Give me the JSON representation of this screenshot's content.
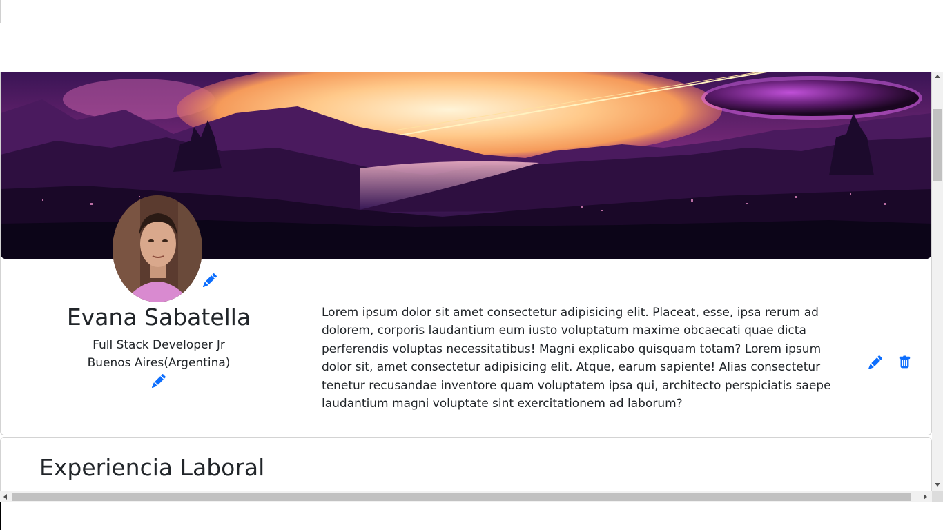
{
  "profile": {
    "name": "Evana Sabatella",
    "job_title": "Full Stack Developer Jr",
    "location": "Buenos Aires(Argentina)",
    "about": "Lorem ipsum dolor sit amet consectetur adipisicing elit. Placeat, esse, ipsa rerum ad dolorem, corporis laudantium eum iusto voluptatum maxime obcaecati quae dicta perferendis voluptas necessitatibus! Magni explicabo quisquam totam? Lorem ipsum dolor sit, amet consectetur adipisicing elit. Atque, earum sapiente! Alias consectetur tenetur recusandae inventore quam voluptatem ipsa qui, architecto perspiciatis saepe laudantium magni voluptate sint exercitationem ad laborum?"
  },
  "sections": {
    "experience_title": "Experiencia Laboral"
  },
  "icons": {
    "edit": "pencil-icon",
    "delete": "trash-icon"
  },
  "colors": {
    "accent": "#0d6efd",
    "text": "#212529"
  }
}
